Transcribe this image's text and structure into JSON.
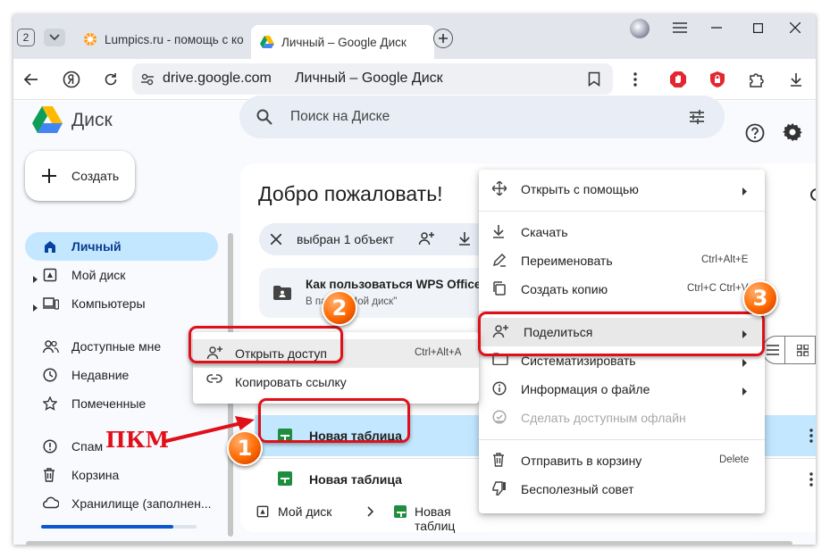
{
  "browser": {
    "tab_counter": "2",
    "tabs": [
      {
        "title": "Lumpics.ru - помощь с ко"
      },
      {
        "title": "Личный – Google Диск"
      }
    ],
    "address": {
      "domain": "drive.google.com",
      "page_title": "Личный – Google Диск"
    }
  },
  "drive": {
    "logo_text": "Диск",
    "search_placeholder": "Поиск на Диске",
    "create_label": "Создать",
    "nav": [
      {
        "label": "Личный"
      },
      {
        "label": "Мой диск"
      },
      {
        "label": "Компьютеры"
      },
      {
        "label": "Доступные мне"
      },
      {
        "label": "Недавние"
      },
      {
        "label": "Помеченные"
      },
      {
        "label": "Спам"
      },
      {
        "label": "Корзина"
      },
      {
        "label": "Хранилище (заполнен..."
      }
    ],
    "storage_fraction": 0.85,
    "welcome_title": "Добро пожаловать!",
    "selection_text": "выбран 1 объект",
    "suggested": {
      "title": "Как пользоваться WPS Office",
      "subtitle": "В папке \"Мой диск\""
    },
    "files": [
      {
        "name": "Новая таблица"
      },
      {
        "name": "Новая таблица"
      }
    ],
    "breadcrumb": {
      "root": "Мой диск",
      "file": "Новая таблиц"
    }
  },
  "context_menu": {
    "items": [
      {
        "label": "Открыть с помощью",
        "shortcut": ""
      },
      {
        "label": "Скачать",
        "shortcut": ""
      },
      {
        "label": "Переименовать",
        "shortcut": "Ctrl+Alt+E"
      },
      {
        "label": "Создать копию",
        "shortcut": "Ctrl+C Ctrl+V"
      },
      {
        "label": "Поделиться",
        "shortcut": ""
      },
      {
        "label": "Систематизировать",
        "shortcut": ""
      },
      {
        "label": "Информация о файле",
        "shortcut": ""
      },
      {
        "label": "Сделать доступным офлайн",
        "shortcut": ""
      },
      {
        "label": "Отправить в корзину",
        "shortcut": "Delete"
      },
      {
        "label": "Бесполезный совет",
        "shortcut": ""
      }
    ]
  },
  "share_submenu": {
    "items": [
      {
        "label": "Открыть доступ",
        "shortcut": "Ctrl+Alt+A"
      },
      {
        "label": "Копировать ссылку",
        "shortcut": ""
      }
    ]
  },
  "annotations": {
    "pkm_label": "ПКМ",
    "badges": [
      "1",
      "2",
      "3"
    ],
    "color": "#e0101a",
    "badge_color": "#ff6a00"
  },
  "colors": {
    "accent": "#0b57d0",
    "selected_bg": "#c2e7ff",
    "sheets_green": "#1e8e3e"
  }
}
